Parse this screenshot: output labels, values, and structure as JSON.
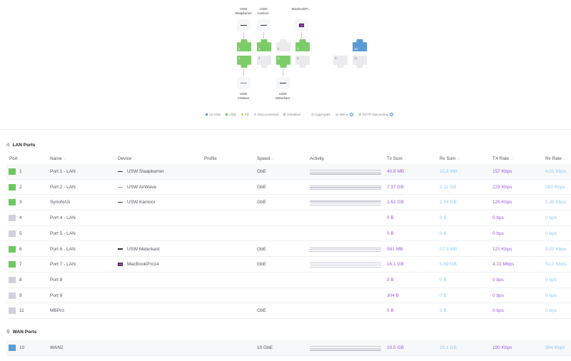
{
  "topology": {
    "devices_top": [
      {
        "label_line1": "USW",
        "label_line2": "Slaapkamer",
        "icon": "switch-icon"
      },
      {
        "label_line1": "USW",
        "label_line2": "Kantoor",
        "icon": "switch-icon"
      },
      {
        "label_line1": "",
        "label_line2": "MacBookPr...",
        "icon": "laptop-icon"
      }
    ],
    "devices_bottom": [
      {
        "label_line1": "USW",
        "label_line2": "AirWave",
        "icon": "switch-icon"
      },
      {
        "label_line1": "USW",
        "label_line2": "Meterkast",
        "icon": "switch-icon"
      }
    ],
    "ports": [
      {
        "n": "1",
        "state": "gbe"
      },
      {
        "n": "2",
        "state": "gbe"
      },
      {
        "n": "3",
        "state": "gbe"
      },
      {
        "n": "4",
        "state": "disconnected"
      },
      {
        "n": "5",
        "state": "disconnected"
      },
      {
        "n": "6",
        "state": "gbe"
      },
      {
        "n": "7",
        "state": "gbe"
      },
      {
        "n": "8",
        "state": "disconnected"
      },
      {
        "n": "9",
        "state": "disconnected"
      },
      {
        "n": "10",
        "state": "10gbe"
      },
      {
        "n": "11",
        "state": "disconnected"
      }
    ]
  },
  "legend": {
    "items": [
      "10 GbE",
      "GbE",
      "FE",
      "Disconnected",
      "Disabled"
    ],
    "aggregate": "Aggregate",
    "mirror": "Mirror",
    "rstp": "RSTP Discarding",
    "colors": {
      "10gbe": "#5b9bd5",
      "gbe": "#6cc860",
      "fe": "#c8e04a",
      "disconnected": "#cfd2d8"
    }
  },
  "lan": {
    "title": "LAN Ports",
    "columns": {
      "port": "Port",
      "name": "Name",
      "device": "Device",
      "profile": "Profile",
      "speed": "Speed",
      "activity": "Activity",
      "tx_sum": "Tx Sum",
      "rx_sum": "Rx Sum",
      "tx_rate": "TX Rate",
      "rx_rate": "Rx Rate"
    },
    "rows": [
      {
        "port": "1",
        "state": "g",
        "name": "Port 1 - LAN",
        "device": "USW Slaapkamer",
        "dicon": "switch",
        "speed": "GbE",
        "tx_sum": "40.8 MB",
        "rx_sum": "15.8 MB",
        "tx_rate": "157 Kbps",
        "rx_rate": "4.01 Kbps"
      },
      {
        "port": "2",
        "state": "g",
        "name": "Port 2 - LAN",
        "device": "USW AirWave",
        "dicon": "thin",
        "speed": "GbE",
        "tx_sum": "7.37 GB",
        "rx_sum": "2.11 GB",
        "tx_rate": "229 Kbps",
        "rx_rate": "283 Kbps"
      },
      {
        "port": "3",
        "state": "g",
        "name": "SynoNAS",
        "device": "USW Kantoor",
        "dicon": "switch",
        "speed": "GbE",
        "tx_sum": "1.62 GB",
        "rx_sum": "2.04 GB",
        "tx_rate": "126 Kbps",
        "rx_rate": "2.39 Kbps"
      },
      {
        "port": "4",
        "state": "d",
        "name": "Port 4 - LAN",
        "device": "",
        "dicon": "",
        "speed": "",
        "tx_sum": "0 B",
        "rx_sum": "0 B",
        "tx_rate": "0 bps",
        "rx_rate": "0 bps"
      },
      {
        "port": "5",
        "state": "d",
        "name": "Port 5 - LAN",
        "device": "",
        "dicon": "",
        "speed": "",
        "tx_sum": "0 B",
        "rx_sum": "0 B",
        "tx_rate": "0 bps",
        "rx_rate": "0 bps"
      },
      {
        "port": "6",
        "state": "g",
        "name": "Port 6 - LAN",
        "device": "USW Meterkast",
        "dicon": "switch",
        "speed": "GbE",
        "tx_sum": "581 MB",
        "rx_sum": "57.9 MB",
        "tx_rate": "121 Kbps",
        "rx_rate": "5.07 Kbps"
      },
      {
        "port": "7",
        "state": "g",
        "name": "Port 7 - LAN",
        "device": "MacBookPro14",
        "dicon": "mac",
        "speed": "GbE",
        "tx_sum": "16.1 GB",
        "rx_sum": "5.69 GB",
        "tx_rate": "4.22 Mbps",
        "rx_rate": "51.0 Kbps"
      },
      {
        "port": "8",
        "state": "d",
        "name": "Port 8",
        "device": "",
        "dicon": "",
        "speed": "",
        "tx_sum": "0 B",
        "rx_sum": "0 B",
        "tx_rate": "0 bps",
        "rx_rate": "0 bps"
      },
      {
        "port": "9",
        "state": "d",
        "name": "Port 9",
        "device": "",
        "dicon": "",
        "speed": "",
        "tx_sum": "304 B",
        "rx_sum": "0 B",
        "tx_rate": "0 bps",
        "rx_rate": "0 bps"
      },
      {
        "port": "11",
        "state": "d",
        "name": "MBPro",
        "device": "",
        "dicon": "",
        "speed": "GbE",
        "tx_sum": "0 B",
        "rx_sum": "0 B",
        "tx_rate": "0 bps",
        "rx_rate": "0 bps"
      }
    ]
  },
  "wan": {
    "title": "WAN Ports",
    "rows": [
      {
        "port": "10",
        "state": "b",
        "name": "WAN2",
        "device": "",
        "dicon": "",
        "speed": "10 GbE",
        "tx_sum": "10.5 GB",
        "rx_sum": "23.1 GB",
        "tx_rate": "190 Kbps",
        "rx_rate": "384 Kbps"
      }
    ]
  }
}
